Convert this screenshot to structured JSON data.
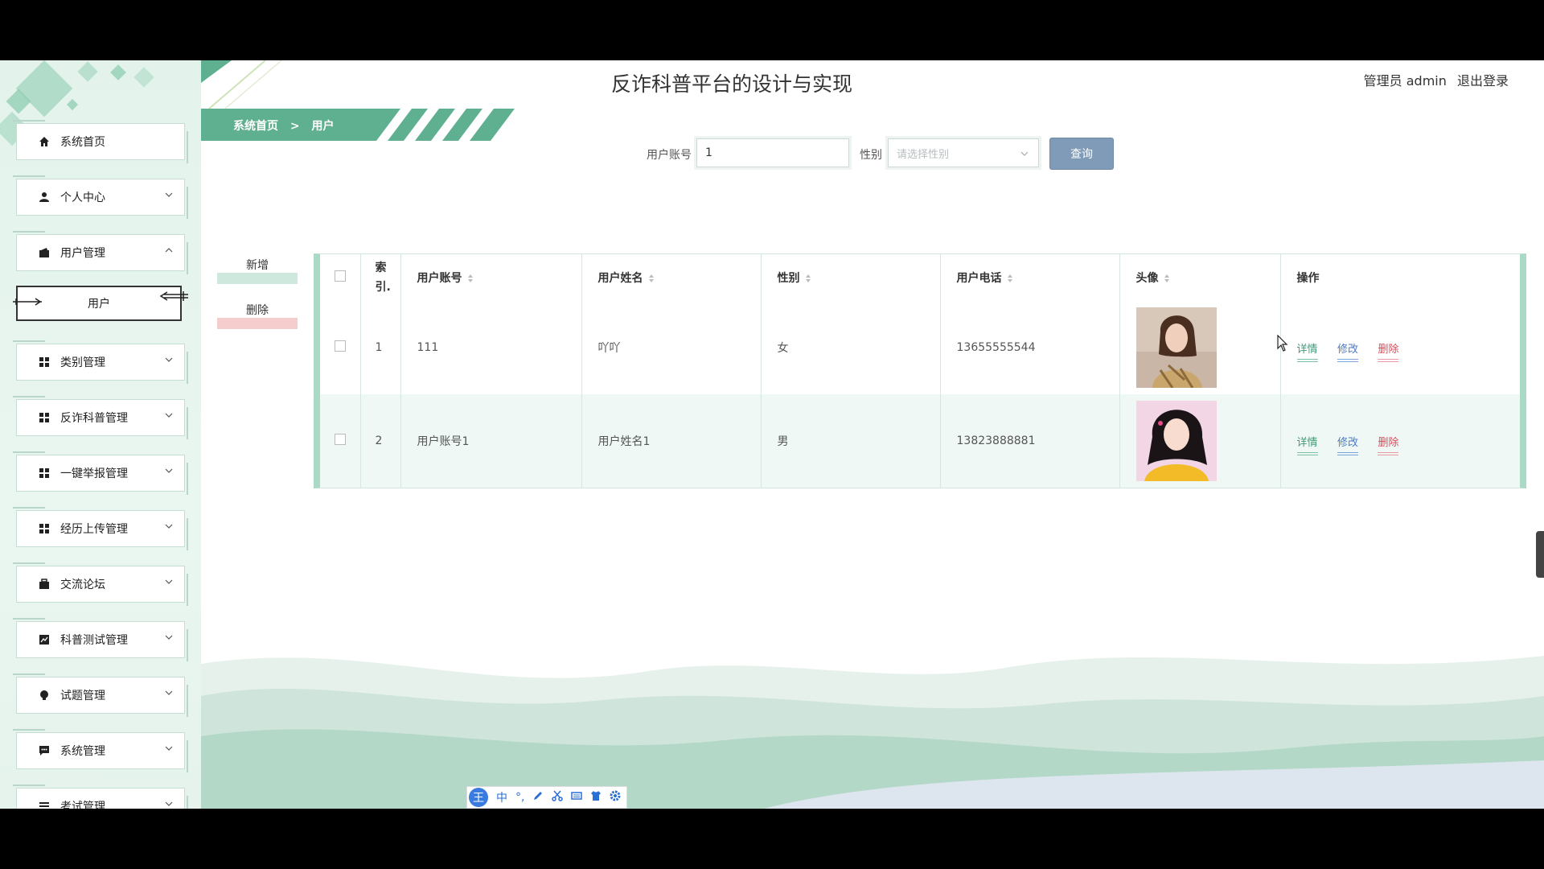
{
  "app": {
    "title": "反诈科普平台的设计与实现"
  },
  "user": {
    "role_name": "管理员 admin",
    "logout": "退出登录"
  },
  "breadcrumb": {
    "home": "系统首页",
    "separator": ">",
    "current": "用户"
  },
  "sidebar": {
    "items": [
      {
        "label": "系统首页",
        "icon": "home-icon"
      },
      {
        "label": "个人中心",
        "icon": "person-icon"
      },
      {
        "label": "用户管理",
        "icon": "wallet-icon",
        "expanded": true
      },
      {
        "label": "类别管理",
        "icon": "grid-icon"
      },
      {
        "label": "反诈科普管理",
        "icon": "grid-icon"
      },
      {
        "label": "一键举报管理",
        "icon": "grid-icon"
      },
      {
        "label": "经历上传管理",
        "icon": "grid-icon"
      },
      {
        "label": "交流论坛",
        "icon": "briefcase-icon"
      },
      {
        "label": "科普测试管理",
        "icon": "chart-icon"
      },
      {
        "label": "试题管理",
        "icon": "bulb-icon"
      },
      {
        "label": "系统管理",
        "icon": "message-icon"
      },
      {
        "label": "考试管理",
        "icon": "list-icon"
      }
    ],
    "submenu_active": "用户"
  },
  "search": {
    "account_label": "用户账号",
    "account_value": "1",
    "gender_label": "性别",
    "gender_placeholder": "请选择性别",
    "query_button": "查询"
  },
  "actions": {
    "add": "新增",
    "delete": "删除"
  },
  "table": {
    "headers": {
      "index": "索引.",
      "account": "用户账号",
      "name": "用户姓名",
      "gender": "性别",
      "phone": "用户电话",
      "avatar": "头像",
      "ops": "操作"
    },
    "rows": [
      {
        "index": "1",
        "account": "111",
        "name": "吖吖",
        "gender": "女",
        "phone": "13655555544",
        "detail": "详情",
        "edit": "修改",
        "delete": "删除"
      },
      {
        "index": "2",
        "account": "用户账号1",
        "name": "用户姓名1",
        "gender": "男",
        "phone": "13823888881",
        "detail": "详情",
        "edit": "修改",
        "delete": "删除"
      }
    ]
  },
  "ime": {
    "logo": "王",
    "mode": "中",
    "punct": "°,"
  },
  "colors": {
    "accent": "#5fb090",
    "sidebar_bg": "#e6f4ee",
    "query_button": "#7f9bb7",
    "detail_link": "#3f9a76",
    "edit_link": "#4a7bc4",
    "delete_link": "#d84b5a"
  }
}
